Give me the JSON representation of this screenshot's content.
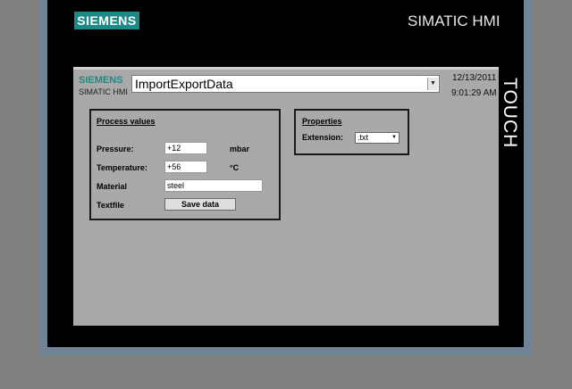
{
  "device": {
    "brand": "SIEMENS",
    "model": "SIMATIC HMI",
    "touch_label": "TOUCH"
  },
  "screen": {
    "header": {
      "brand": "SIEMENS",
      "sub": "SIMATIC HMI",
      "screen_name": "ImportExportData",
      "date": "12/13/2011",
      "time": "9:01:29 AM"
    },
    "process_values": {
      "title": "Process values",
      "pressure_label": "Pressure:",
      "pressure_value": "+12",
      "pressure_unit": "mbar",
      "temperature_label": "Temperature:",
      "temperature_value": "+56",
      "temperature_unit": "°C",
      "material_label": "Material",
      "material_value": "steel",
      "textfile_label": "Textfile",
      "save_button": "Save data"
    },
    "properties": {
      "title": "Properties",
      "extension_label": "Extension:",
      "extension_value": ".txt"
    }
  },
  "colors": {
    "siemens_teal": "#1e8a87",
    "screen_background": "#a9a9a9",
    "bezel": "#000000",
    "frame": "#6f8296"
  }
}
